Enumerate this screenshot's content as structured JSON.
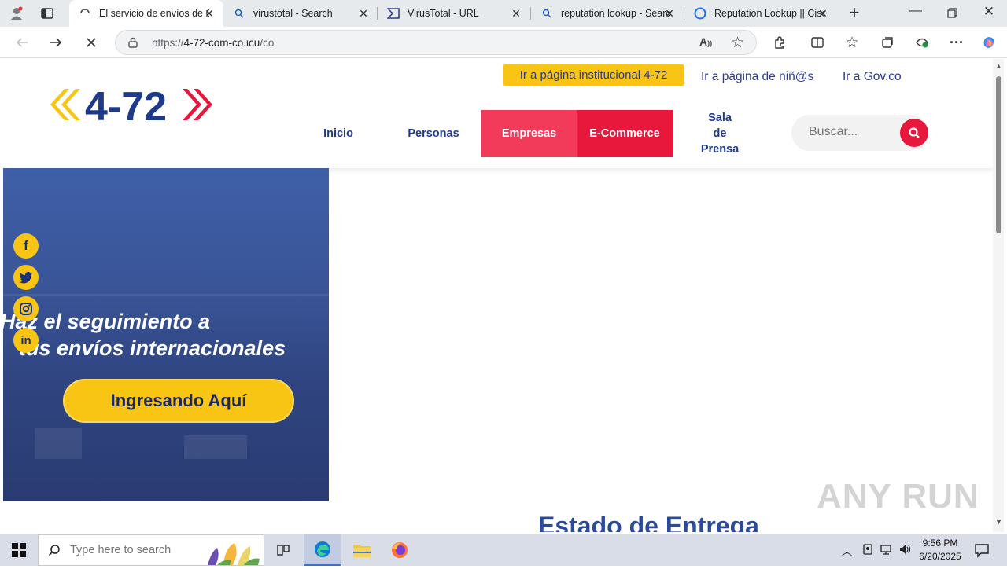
{
  "browser": {
    "tabs": [
      {
        "label": "El servicio de envíos de C",
        "icon": "loading-icon",
        "active": true
      },
      {
        "label": "virustotal - Search",
        "icon": "search-icon"
      },
      {
        "label": "VirusTotal - URL",
        "icon": "virustotal-icon"
      },
      {
        "label": "reputation lookup - Searc",
        "icon": "search-icon"
      },
      {
        "label": "Reputation Lookup || Cisc",
        "icon": "globe-icon"
      }
    ],
    "url_prefix": "https://",
    "url_host": "4-72-com-co.icu",
    "url_path": "/co"
  },
  "site": {
    "logo_text": "4-72",
    "inst_link": "Ir a página institucional 4-72",
    "kids_link": "Ir a página de niñ@s",
    "gov_link": "Ir a Gov.co",
    "nav": [
      {
        "label": "Inicio"
      },
      {
        "label": "Personas"
      },
      {
        "label": "Empresas"
      },
      {
        "label": "E-Commerce"
      },
      {
        "label": "Sala de Prensa"
      }
    ],
    "search_placeholder": "Buscar...",
    "banner_line1": "Haz el seguimiento a",
    "banner_line2": "tus envíos internacionales",
    "banner_button": "Ingresando Aquí",
    "estado_title": "Estado de Entrega",
    "watermark": "ANY RUN"
  },
  "taskbar": {
    "search_placeholder": "Type here to search",
    "time": "9:56 PM",
    "date": "6/20/2025"
  },
  "colors": {
    "brand_blue": "#1e3a8a",
    "brand_red": "#e8173c",
    "brand_yellow": "#f9c514"
  }
}
